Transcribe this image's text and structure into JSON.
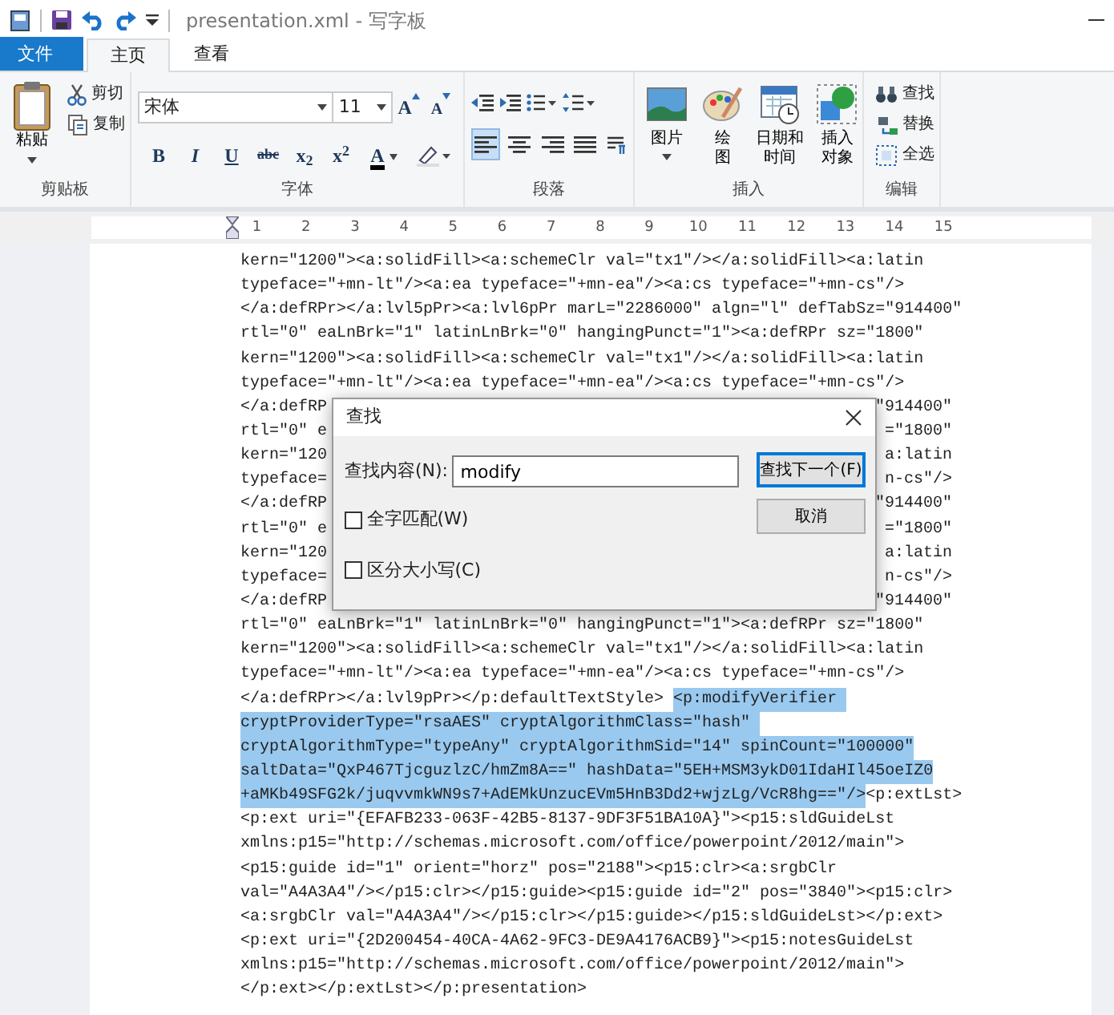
{
  "window": {
    "title": "presentation.xml - 写字板"
  },
  "menu_tabs": [
    {
      "label": "文件",
      "kind": "file",
      "selected": false
    },
    {
      "label": "主页",
      "kind": "tab",
      "selected": true
    },
    {
      "label": "查看",
      "kind": "tab",
      "selected": false
    }
  ],
  "ribbon": {
    "clipboard": {
      "paste": "粘贴",
      "cut": "剪切",
      "copy": "复制",
      "group": "剪贴板"
    },
    "font": {
      "family": "宋体",
      "size": "11",
      "grow": "A",
      "shrink": "A",
      "group": "字体",
      "format_buttons": [
        {
          "kind": "bold",
          "glyph": "B"
        },
        {
          "kind": "italic",
          "glyph": "I"
        },
        {
          "kind": "underline",
          "glyph": "U"
        },
        {
          "kind": "strike",
          "glyph": "abc"
        },
        {
          "kind": "sub",
          "glyph": "x$_{2}$"
        },
        {
          "kind": "sup",
          "glyph": "x$^{2}$"
        }
      ],
      "color_glyph": "A"
    },
    "paragraph": {
      "group": "段落",
      "align": [
        {
          "kind": "left",
          "selected": true
        },
        {
          "kind": "center",
          "selected": false
        },
        {
          "kind": "right",
          "selected": false
        },
        {
          "kind": "justify",
          "selected": false
        }
      ]
    },
    "insert": {
      "group": "插入",
      "items": [
        {
          "kind": "picture",
          "lines": [
            "图片"
          ],
          "dropdown": true
        },
        {
          "kind": "paint",
          "lines": [
            "绘",
            "图"
          ],
          "dropdown": false
        },
        {
          "kind": "datetime",
          "lines": [
            "日期和",
            "时间"
          ],
          "dropdown": false
        },
        {
          "kind": "object",
          "lines": [
            "插入",
            "对象"
          ],
          "dropdown": false
        }
      ]
    },
    "editing": {
      "group": "编辑",
      "items": [
        {
          "kind": "find",
          "label": "查找"
        },
        {
          "kind": "replace",
          "label": "替换"
        },
        {
          "kind": "select_all",
          "label": "全选"
        }
      ]
    }
  },
  "ruler": {
    "ticks": [
      "1",
      "2",
      "3",
      "4",
      "5",
      "6",
      "7",
      "8",
      "9",
      "10",
      "11",
      "12",
      "13",
      "14",
      "15"
    ]
  },
  "document": {
    "lines": [
      {
        "kind": "plain",
        "spans": [
          {
            "text": "kern=\"1200\"><a:solidFill><a:schemeClr val=\"tx1\"/></a:solidFill><a:latin",
            "selected": false
          }
        ]
      },
      {
        "kind": "plain",
        "spans": [
          {
            "text": "typeface=\"+mn-lt\"/><a:ea typeface=\"+mn-ea\"/><a:cs typeface=\"+mn-cs\"/>",
            "selected": false
          }
        ]
      },
      {
        "kind": "plain",
        "spans": [
          {
            "text": "</a:defRPr></a:lvl5pPr><a:lvl6pPr marL=\"2286000\" algn=\"l\" defTabSz=\"914400\"",
            "selected": false
          }
        ]
      },
      {
        "kind": "plain",
        "spans": [
          {
            "text": "rtl=\"0\" eaLnBrk=\"1\" latinLnBrk=\"0\" hangingPunct=\"1\"><a:defRPr sz=\"1800\"",
            "selected": false
          }
        ]
      },
      {
        "kind": "plain",
        "spans": [
          {
            "text": "kern=\"1200\"><a:solidFill><a:schemeClr val=\"tx1\"/></a:solidFill><a:latin",
            "selected": false
          }
        ]
      },
      {
        "kind": "plain",
        "spans": [
          {
            "text": "typeface=\"+mn-lt\"/><a:ea typeface=\"+mn-ea\"/><a:cs typeface=\"+mn-cs\"/>",
            "selected": false
          }
        ]
      },
      {
        "kind": "covered",
        "left": "</a:defRP",
        "right": "\"914400\""
      },
      {
        "kind": "covered",
        "left": "rtl=\"0\" e",
        "right": "=\"1800\""
      },
      {
        "kind": "covered",
        "left": "kern=\"120",
        "right": "a:latin"
      },
      {
        "kind": "covered",
        "left": "typeface=",
        "right": "n-cs\"/>"
      },
      {
        "kind": "covered",
        "left": "</a:defRP",
        "right": "\"914400\""
      },
      {
        "kind": "covered",
        "left": "rtl=\"0\" e",
        "right": "=\"1800\""
      },
      {
        "kind": "covered",
        "left": "kern=\"120",
        "right": "a:latin"
      },
      {
        "kind": "covered",
        "left": "typeface=",
        "right": "n-cs\"/>"
      },
      {
        "kind": "covered",
        "left": "</a:defRP",
        "right": "\"914400\""
      },
      {
        "kind": "plain",
        "spans": [
          {
            "text": "rtl=\"0\" eaLnBrk=\"1\" latinLnBrk=\"0\" hangingPunct=\"1\"><a:defRPr sz=\"1800\"",
            "selected": false
          }
        ]
      },
      {
        "kind": "plain",
        "spans": [
          {
            "text": "kern=\"1200\"><a:solidFill><a:schemeClr val=\"tx1\"/></a:solidFill><a:latin",
            "selected": false
          }
        ]
      },
      {
        "kind": "plain",
        "spans": [
          {
            "text": "typeface=\"+mn-lt\"/><a:ea typeface=\"+mn-ea\"/><a:cs typeface=\"+mn-cs\"/>",
            "selected": false
          }
        ]
      },
      {
        "kind": "plain",
        "spans": [
          {
            "text": "</a:defRPr></a:lvl9pPr></p:defaultTextStyle> ",
            "selected": false
          },
          {
            "text": "<p:modifyVerifier ",
            "selected": true
          }
        ]
      },
      {
        "kind": "plain",
        "spans": [
          {
            "text": "cryptProviderType=\"rsaAES\" cryptAlgorithmClass=\"hash\" ",
            "selected": true
          }
        ]
      },
      {
        "kind": "plain",
        "spans": [
          {
            "text": "cryptAlgorithmType=\"typeAny\" cryptAlgorithmSid=\"14\" spinCount=\"100000\"",
            "selected": true
          }
        ]
      },
      {
        "kind": "plain",
        "spans": [
          {
            "text": "saltData=\"QxP467TjcguzlzC/hmZm8A==\" hashData=\"5EH+MSM3ykD01IdaHIl45oeIZ0",
            "selected": true
          }
        ]
      },
      {
        "kind": "plain",
        "spans": [
          {
            "text": "+aMKb49SFG2k/juqvvmkWN9s7+AdEMkUnzucEVm5HnB3Dd2+wjzLg/VcR8hg==\"/>",
            "selected": true
          },
          {
            "text": "<p:extLst>",
            "selected": false
          }
        ]
      },
      {
        "kind": "plain",
        "spans": [
          {
            "text": "<p:ext uri=\"{EFAFB233-063F-42B5-8137-9DF3F51BA10A}\"><p15:sldGuideLst",
            "selected": false
          }
        ]
      },
      {
        "kind": "plain",
        "spans": [
          {
            "text": "xmlns:p15=\"http://schemas.microsoft.com/office/powerpoint/2012/main\">",
            "selected": false
          }
        ]
      },
      {
        "kind": "plain",
        "spans": [
          {
            "text": "<p15:guide id=\"1\" orient=\"horz\" pos=\"2188\"><p15:clr><a:srgbClr",
            "selected": false
          }
        ]
      },
      {
        "kind": "plain",
        "spans": [
          {
            "text": "val=\"A4A3A4\"/></p15:clr></p15:guide><p15:guide id=\"2\" pos=\"3840\"><p15:clr>",
            "selected": false
          }
        ]
      },
      {
        "kind": "plain",
        "spans": [
          {
            "text": "<a:srgbClr val=\"A4A3A4\"/></p15:clr></p15:guide></p15:sldGuideLst></p:ext>",
            "selected": false
          }
        ]
      },
      {
        "kind": "plain",
        "spans": [
          {
            "text": "<p:ext uri=\"{2D200454-40CA-4A62-9FC3-DE9A4176ACB9}\"><p15:notesGuideLst",
            "selected": false
          }
        ]
      },
      {
        "kind": "plain",
        "spans": [
          {
            "text": "xmlns:p15=\"http://schemas.microsoft.com/office/powerpoint/2012/main\">",
            "selected": false
          }
        ]
      },
      {
        "kind": "plain",
        "spans": [
          {
            "text": "</p:ext></p:extLst></p:presentation>",
            "selected": false
          }
        ]
      }
    ]
  },
  "find_dialog": {
    "title": "查找",
    "find_label": "查找内容(N):",
    "query": "modify",
    "options": [
      {
        "label": "全字匹配(W)",
        "checked": false
      },
      {
        "label": "区分大小写(C)",
        "checked": false
      }
    ],
    "buttons": [
      {
        "label": "查找下一个(F)",
        "default": true
      },
      {
        "label": "取消",
        "default": false
      }
    ]
  }
}
